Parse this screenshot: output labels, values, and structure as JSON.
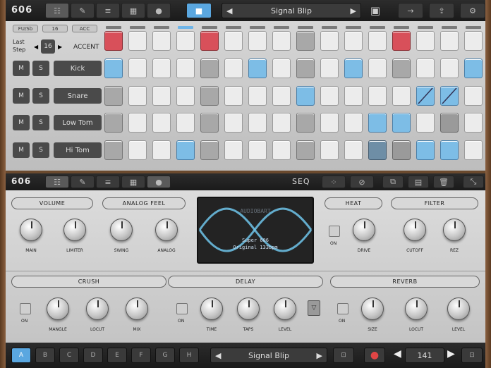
{
  "app": {
    "logo": "606"
  },
  "top": {
    "pattern_name": "Signal Blip",
    "left_arrow": "◀",
    "right_arrow": "▶"
  },
  "seq": {
    "controls": {
      "ratio": "FU/Sb",
      "steps16": "16",
      "acc": "ACC",
      "last_step_label": "Last Step",
      "last_step_value": "16",
      "accent_label": "ACCENT"
    },
    "tracks": [
      {
        "mute": "M",
        "solo": "S",
        "name": "Kick"
      },
      {
        "mute": "M",
        "solo": "S",
        "name": "Snare"
      },
      {
        "mute": "M",
        "solo": "S",
        "name": "Low Tom"
      },
      {
        "mute": "M",
        "solo": "S",
        "name": "Hi Tom"
      }
    ],
    "active_step_indicator": 3
  },
  "midbar": {
    "logo": "606",
    "seq_label": "SEQ"
  },
  "sections": {
    "volume": "VOLUME",
    "analog_feel": "ANALOG FEEL",
    "heat": "HEAT",
    "filter": "FILTER",
    "crush": "CRUSH",
    "delay": "DELAY",
    "reverb": "REVERB"
  },
  "knobs": {
    "main": "MAIN",
    "limiter": "LIMITER",
    "swing": "SWING",
    "analog": "ANALOG",
    "drive": "DRIVE",
    "cutoff": "CUTOFF",
    "rez": "REZ",
    "mangle": "MANGLE",
    "locut": "LOCUT",
    "mix": "MIX",
    "time": "TIME",
    "taps": "TAPS",
    "level": "LEVEL",
    "size": "SIZE",
    "locut2": "LOCUT",
    "level2": "LEVEL",
    "on": "ON"
  },
  "scope": {
    "title": "AUDIOBART",
    "line1": "Super 606",
    "line2": "Original 133bpm"
  },
  "bottom": {
    "patterns": [
      "A",
      "B",
      "C",
      "D",
      "E",
      "F",
      "G",
      "H"
    ],
    "selected_pattern": "A",
    "pattern_name": "Signal Blip",
    "tempo": "141"
  },
  "colors": {
    "accent_red": "#d8505a",
    "step_blue": "#7dbde6",
    "highlight": "#5aa7e0"
  }
}
